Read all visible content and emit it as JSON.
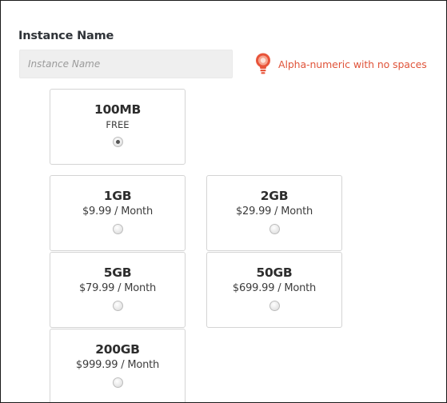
{
  "form": {
    "instance_name_label": "Instance Name",
    "instance_name_placeholder": "Instance Name",
    "instance_name_value": "",
    "hint_text": "Alpha-numeric with no spaces",
    "hint_color": "#e0543a"
  },
  "plans": [
    {
      "size": "100MB",
      "price": "FREE",
      "selected": true
    },
    {
      "size": "1GB",
      "price": "$9.99 / Month",
      "selected": false
    },
    {
      "size": "2GB",
      "price": "$29.99 / Month",
      "selected": false
    },
    {
      "size": "5GB",
      "price": "$79.99 / Month",
      "selected": false
    },
    {
      "size": "50GB",
      "price": "$699.99 / Month",
      "selected": false
    },
    {
      "size": "200GB",
      "price": "$999.99 / Month",
      "selected": false
    }
  ],
  "icons": {
    "hint_icon": "lightbulb-icon"
  }
}
